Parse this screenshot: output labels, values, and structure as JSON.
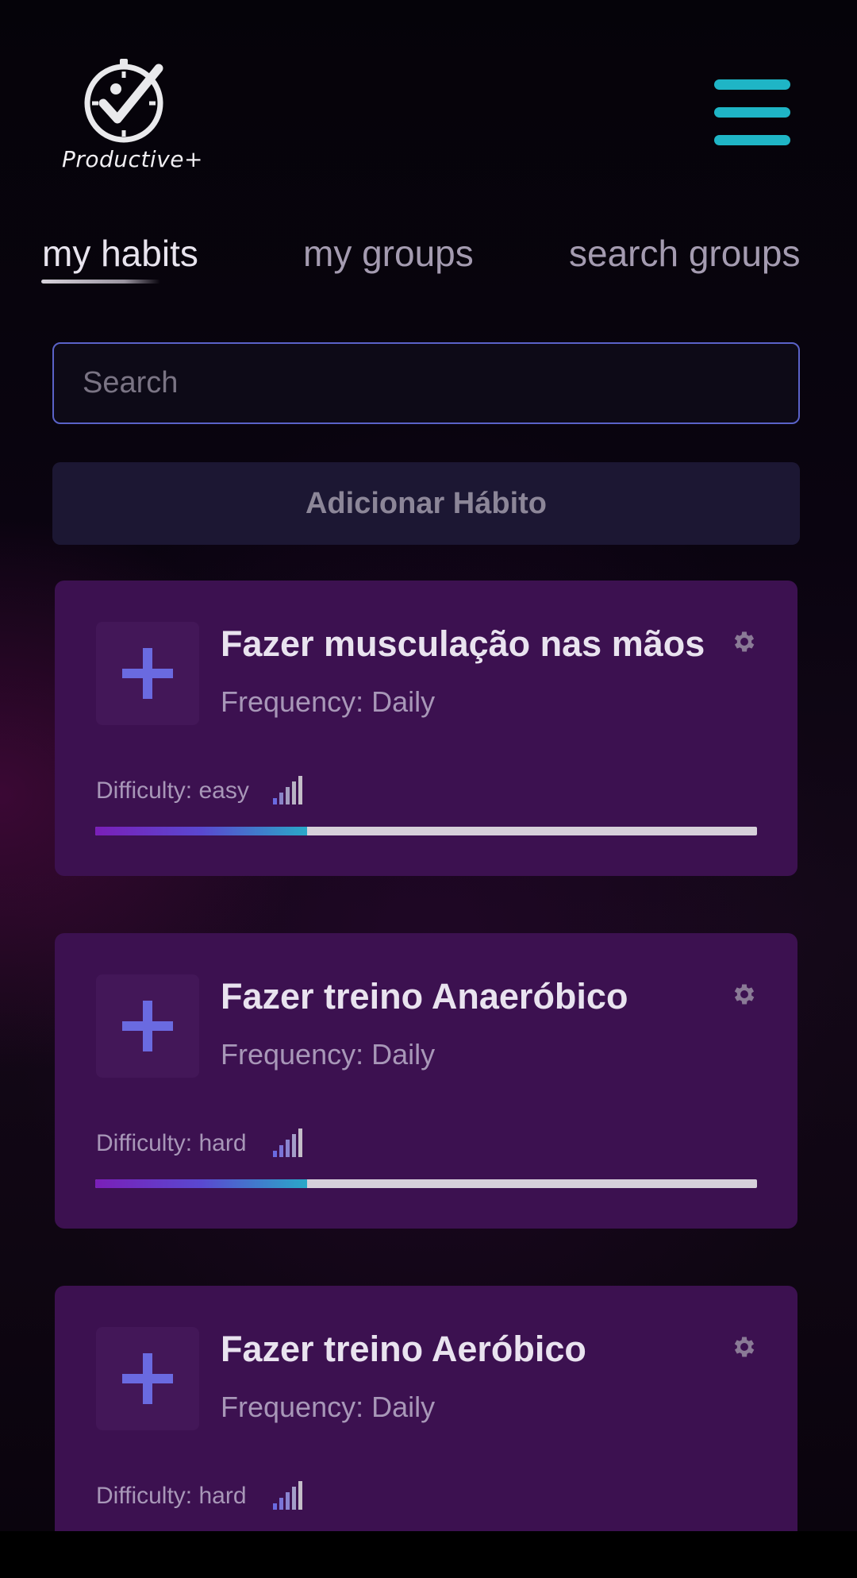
{
  "app": {
    "logo_text": "Productive+"
  },
  "tabs": [
    {
      "label": "my habits",
      "active": true
    },
    {
      "label": "my groups",
      "active": false
    },
    {
      "label": "search groups",
      "active": false
    }
  ],
  "search": {
    "placeholder": "Search",
    "value": ""
  },
  "add_button_label": "Adicionar Hábito",
  "habits": [
    {
      "title": "Fazer musculação nas mãos",
      "frequency": "Frequency: Daily",
      "difficulty": "Difficulty: easy",
      "progress": 0.32
    },
    {
      "title": "Fazer treino Anaeróbico",
      "frequency": "Frequency: Daily",
      "difficulty": "Difficulty: hard",
      "progress": 0.32
    },
    {
      "title": "Fazer treino Aeróbico",
      "frequency": "Frequency: Daily",
      "difficulty": "Difficulty: hard",
      "progress": null
    }
  ],
  "colors": {
    "accent_menu": "#1fb5c6",
    "card_bg": "#3c1150",
    "plus_icon": "#6a6ae0",
    "input_border": "#5a62c8"
  },
  "icons": {
    "logo": "stopwatch-check-icon",
    "menu": "hamburger-menu-icon",
    "add": "plus-icon",
    "settings": "gear-icon",
    "difficulty": "signal-bars-icon"
  }
}
